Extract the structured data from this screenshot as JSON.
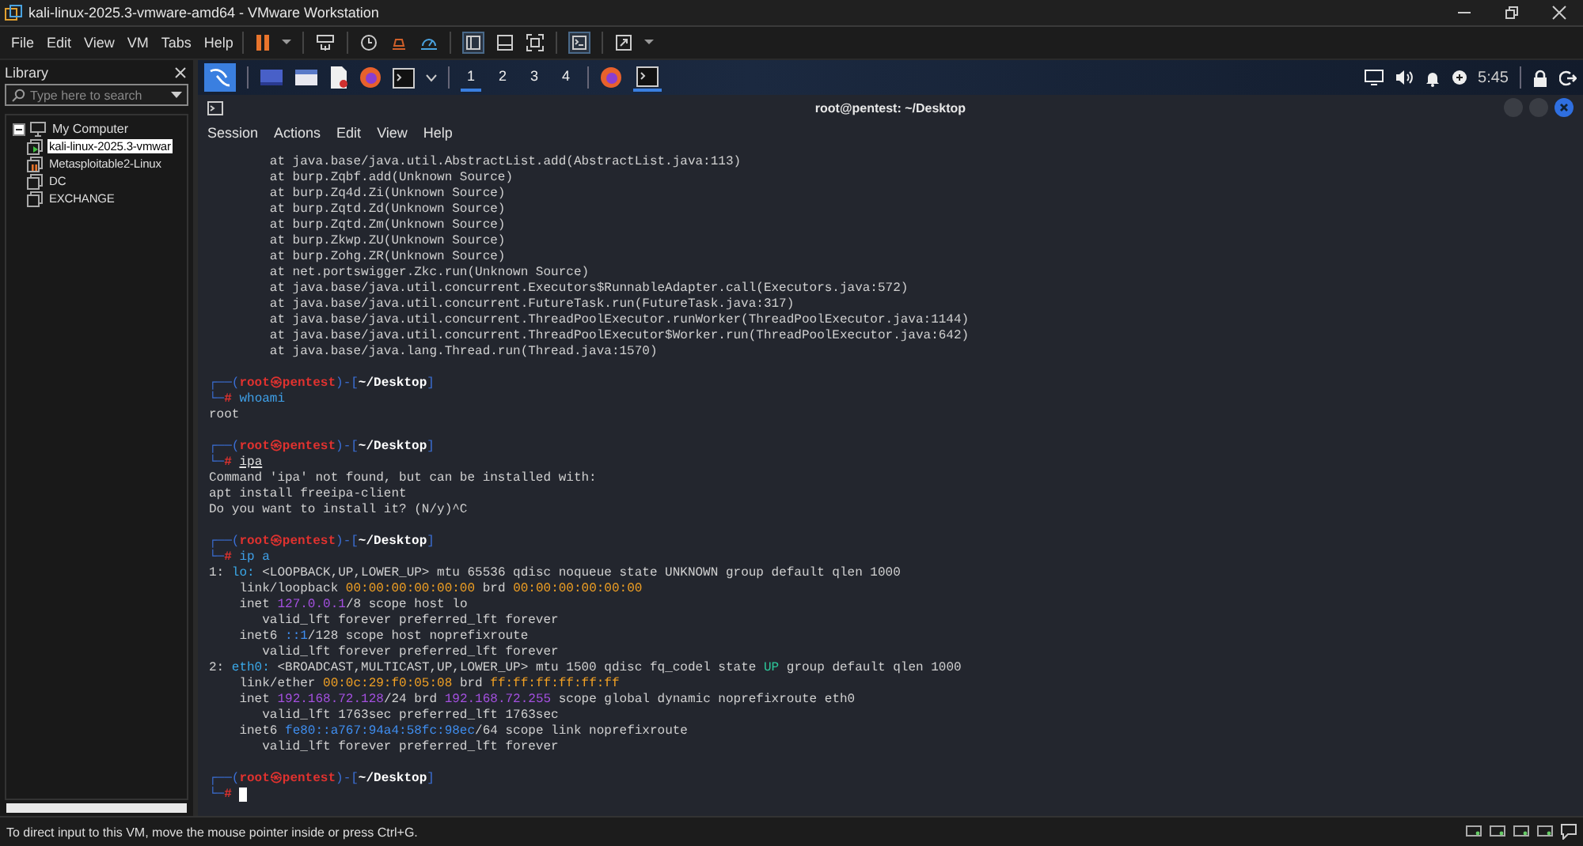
{
  "window": {
    "title": "kali-linux-2025.3-vmware-amd64 - VMware Workstation"
  },
  "menu": [
    "File",
    "Edit",
    "View",
    "VM",
    "Tabs",
    "Help"
  ],
  "library": {
    "title": "Library",
    "search": {
      "placeholder": "Type here to search"
    },
    "tree": [
      {
        "label": "My Computer",
        "expanded": true,
        "selected": false,
        "kind": "host",
        "children": [
          {
            "label": "kali-linux-2025.3-vmwar",
            "selected": true,
            "kind": "running"
          },
          {
            "label": "Metasploitable2-Linux",
            "selected": false,
            "kind": "paused"
          },
          {
            "label": "DC",
            "selected": false,
            "kind": "off"
          },
          {
            "label": "EXCHANGE",
            "selected": false,
            "kind": "off"
          }
        ]
      }
    ]
  },
  "guest_panel": {
    "workspaces": [
      {
        "label": "1",
        "selected": true
      },
      {
        "label": "2",
        "selected": false
      },
      {
        "label": "3",
        "selected": false
      },
      {
        "label": "4",
        "selected": false
      }
    ],
    "clock": "5:45"
  },
  "terminal": {
    "title": "root@pentest: ~/Desktop",
    "menu": [
      "Session",
      "Actions",
      "Edit",
      "View",
      "Help"
    ],
    "lines": [
      {
        "segments": [
          {
            "text": "        at java.base/java.util.AbstractList.add(AbstractList.java:113)",
            "kind": "plain"
          }
        ]
      },
      {
        "segments": [
          {
            "text": "        at burp.Zqbf.add(Unknown Source)",
            "kind": "plain"
          }
        ]
      },
      {
        "segments": [
          {
            "text": "        at burp.Zq4d.Zi(Unknown Source)",
            "kind": "plain"
          }
        ]
      },
      {
        "segments": [
          {
            "text": "        at burp.Zqtd.Zd(Unknown Source)",
            "kind": "plain"
          }
        ]
      },
      {
        "segments": [
          {
            "text": "        at burp.Zqtd.Zm(Unknown Source)",
            "kind": "plain"
          }
        ]
      },
      {
        "segments": [
          {
            "text": "        at burp.Zkwp.ZU(Unknown Source)",
            "kind": "plain"
          }
        ]
      },
      {
        "segments": [
          {
            "text": "        at burp.Zohg.ZR(Unknown Source)",
            "kind": "plain"
          }
        ]
      },
      {
        "segments": [
          {
            "text": "        at net.portswigger.Zkc.run(Unknown Source)",
            "kind": "plain"
          }
        ]
      },
      {
        "segments": [
          {
            "text": "        at java.base/java.util.concurrent.Executors$RunnableAdapter.call(Executors.java:572)",
            "kind": "plain"
          }
        ]
      },
      {
        "segments": [
          {
            "text": "        at java.base/java.util.concurrent.FutureTask.run(FutureTask.java:317)",
            "kind": "plain"
          }
        ]
      },
      {
        "segments": [
          {
            "text": "        at java.base/java.util.concurrent.ThreadPoolExecutor.runWorker(ThreadPoolExecutor.java:1144)",
            "kind": "plain"
          }
        ]
      },
      {
        "segments": [
          {
            "text": "        at java.base/java.util.concurrent.ThreadPoolExecutor$Worker.run(ThreadPoolExecutor.java:642)",
            "kind": "plain"
          }
        ]
      },
      {
        "segments": [
          {
            "text": "        at java.base/java.lang.Thread.run(Thread.java:1570)",
            "kind": "plain"
          }
        ]
      },
      {
        "kind": "blank"
      },
      {
        "segments": [
          {
            "text": "┌──(",
            "kind": "frame"
          },
          {
            "text": "root㉿pentest",
            "kind": "user"
          },
          {
            "text": ")-[",
            "kind": "frame"
          },
          {
            "text": "~/Desktop",
            "kind": "path"
          },
          {
            "text": "]",
            "kind": "frame"
          }
        ]
      },
      {
        "segments": [
          {
            "text": "└─",
            "kind": "frame"
          },
          {
            "text": "#",
            "kind": "user"
          },
          {
            "text": " whoami",
            "kind": "cmd"
          }
        ]
      },
      {
        "segments": [
          {
            "text": "root",
            "kind": "plain"
          }
        ]
      },
      {
        "kind": "blank"
      },
      {
        "segments": [
          {
            "text": "┌──(",
            "kind": "frame"
          },
          {
            "text": "root㉿pentest",
            "kind": "user"
          },
          {
            "text": ")-[",
            "kind": "frame"
          },
          {
            "text": "~/Desktop",
            "kind": "path"
          },
          {
            "text": "]",
            "kind": "frame"
          }
        ]
      },
      {
        "segments": [
          {
            "text": "└─",
            "kind": "frame"
          },
          {
            "text": "#",
            "kind": "user"
          },
          {
            "text": "ipa",
            "kind": "badcmd"
          }
        ]
      },
      {
        "segments": [
          {
            "text": "Command 'ipa' not found, but can be installed with:",
            "kind": "plain"
          }
        ]
      },
      {
        "segments": [
          {
            "text": "apt install freeipa-client",
            "kind": "plain"
          }
        ]
      },
      {
        "segments": [
          {
            "text": "Do you want to install it? (N/y)^C",
            "kind": "plain"
          }
        ]
      },
      {
        "kind": "blank"
      },
      {
        "segments": [
          {
            "text": "┌──(",
            "kind": "frame"
          },
          {
            "text": "root㉿pentest",
            "kind": "user"
          },
          {
            "text": ")-[",
            "kind": "frame"
          },
          {
            "text": "~/Desktop",
            "kind": "path"
          },
          {
            "text": "]",
            "kind": "frame"
          }
        ]
      },
      {
        "segments": [
          {
            "text": "└─",
            "kind": "frame"
          },
          {
            "text": "#",
            "kind": "user"
          },
          {
            "text": " ip a",
            "kind": "cmd"
          }
        ]
      },
      {
        "segments": [
          {
            "text": "1: ",
            "kind": "plain"
          },
          {
            "text": "lo:",
            "kind": "iface"
          },
          {
            "text": " <LOOPBACK,UP,LOWER_UP> mtu 65536 qdisc noqueue state UNKNOWN group default qlen 1000",
            "kind": "plain"
          }
        ]
      },
      {
        "segments": [
          {
            "text": "    link/loopback ",
            "kind": "plain"
          },
          {
            "text": "00:00:00:00:00:00",
            "kind": "mac"
          },
          {
            "text": " brd ",
            "kind": "plain"
          },
          {
            "text": "00:00:00:00:00:00",
            "kind": "mac"
          }
        ]
      },
      {
        "segments": [
          {
            "text": "    inet ",
            "kind": "plain"
          },
          {
            "text": "127.0.0.1",
            "kind": "ip"
          },
          {
            "text": "/8 scope host lo",
            "kind": "plain"
          }
        ]
      },
      {
        "segments": [
          {
            "text": "       valid_lft forever preferred_lft forever",
            "kind": "plain"
          }
        ]
      },
      {
        "segments": [
          {
            "text": "    inet6 ",
            "kind": "plain"
          },
          {
            "text": "::1",
            "kind": "ip6"
          },
          {
            "text": "/128 scope host noprefixroute",
            "kind": "plain"
          }
        ]
      },
      {
        "segments": [
          {
            "text": "       valid_lft forever preferred_lft forever",
            "kind": "plain"
          }
        ]
      },
      {
        "segments": [
          {
            "text": "2: ",
            "kind": "plain"
          },
          {
            "text": "eth0:",
            "kind": "iface"
          },
          {
            "text": " <BROADCAST,MULTICAST,UP,LOWER_UP> mtu 1500 qdisc fq_codel state ",
            "kind": "plain"
          },
          {
            "text": "UP",
            "kind": "up"
          },
          {
            "text": " group default qlen 1000",
            "kind": "plain"
          }
        ]
      },
      {
        "segments": [
          {
            "text": "    link/ether ",
            "kind": "plain"
          },
          {
            "text": "00:0c:29:f0:05:08",
            "kind": "mac"
          },
          {
            "text": " brd ",
            "kind": "plain"
          },
          {
            "text": "ff:ff:ff:ff:ff:ff",
            "kind": "mac"
          }
        ]
      },
      {
        "segments": [
          {
            "text": "    inet ",
            "kind": "plain"
          },
          {
            "text": "192.168.72.128",
            "kind": "ip"
          },
          {
            "text": "/24 brd ",
            "kind": "plain"
          },
          {
            "text": "192.168.72.255",
            "kind": "ip"
          },
          {
            "text": " scope global dynamic noprefixroute eth0",
            "kind": "plain"
          }
        ]
      },
      {
        "segments": [
          {
            "text": "       valid_lft 1763sec preferred_lft 1763sec",
            "kind": "plain"
          }
        ]
      },
      {
        "segments": [
          {
            "text": "    inet6 ",
            "kind": "plain"
          },
          {
            "text": "fe80::a767:94a4:58fc:98ec",
            "kind": "ip6"
          },
          {
            "text": "/64 scope link noprefixroute",
            "kind": "plain"
          }
        ]
      },
      {
        "segments": [
          {
            "text": "       valid_lft forever preferred_lft forever",
            "kind": "plain"
          }
        ]
      },
      {
        "kind": "blank"
      },
      {
        "segments": [
          {
            "text": "┌──(",
            "kind": "frame"
          },
          {
            "text": "root㉿pentest",
            "kind": "user"
          },
          {
            "text": ")-[",
            "kind": "frame"
          },
          {
            "text": "~/Desktop",
            "kind": "path"
          },
          {
            "text": "]",
            "kind": "frame"
          }
        ]
      },
      {
        "segments": [
          {
            "text": "└─",
            "kind": "frame"
          },
          {
            "text": "#",
            "kind": "user"
          }
        ],
        "cursor": true
      }
    ]
  },
  "status_bar": {
    "text": "To direct input to this VM, move the mouse pointer inside or press Ctrl+G."
  }
}
